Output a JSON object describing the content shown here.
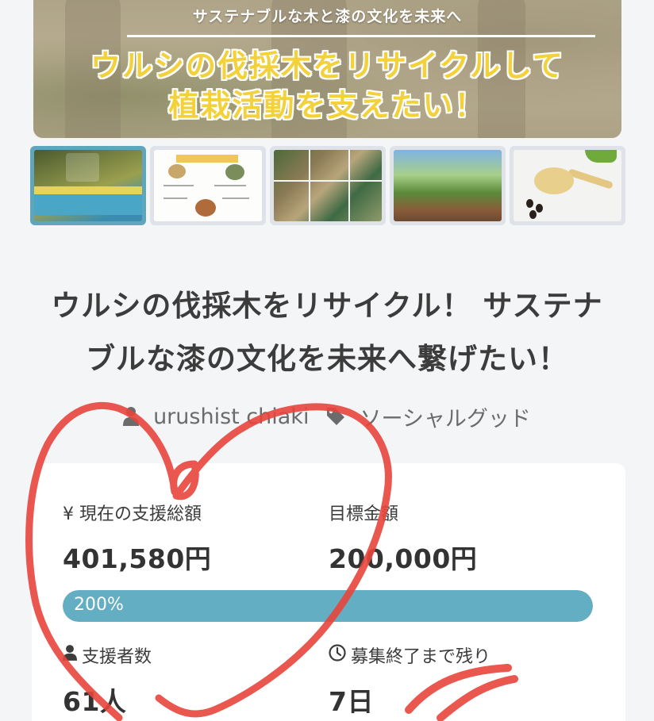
{
  "hero": {
    "subtitle": "サステナブルな木と漆の文化を未来へ",
    "title_line1": "ウルシの伐採木をリサイクルして",
    "title_line2": "植栽活動を支えたい！"
  },
  "thumbnails": [
    {
      "name": "thumbnail-1",
      "active": true
    },
    {
      "name": "thumbnail-2",
      "active": false
    },
    {
      "name": "thumbnail-3",
      "active": false
    },
    {
      "name": "thumbnail-4",
      "active": false
    },
    {
      "name": "thumbnail-5",
      "active": false
    }
  ],
  "project": {
    "title_line1": "ウルシの伐採木をリサイクル！ サステナ",
    "title_line2": "ブルな漆の文化を未来へ繋げたい！",
    "owner": "urushist chiaki",
    "category": "ソーシャルグッド"
  },
  "stats": {
    "current_label": "¥ 現在の支援総額",
    "current_value": "401,580円",
    "goal_label": "目標金額",
    "goal_value": "200,000円",
    "progress_text": "200%",
    "progress_fraction": 1.0,
    "supporters_label": "支援者数",
    "supporters_value": "61人",
    "remaining_label": "募集終了まで残り",
    "remaining_value": "7日"
  },
  "colors": {
    "accent": "#64aec3",
    "hero_title": "#f2d13a",
    "annotation": "#e8453c"
  },
  "icons": {
    "owner": "user-icon",
    "category": "tag-icon",
    "supporters": "user-icon",
    "remaining": "clock-icon"
  }
}
